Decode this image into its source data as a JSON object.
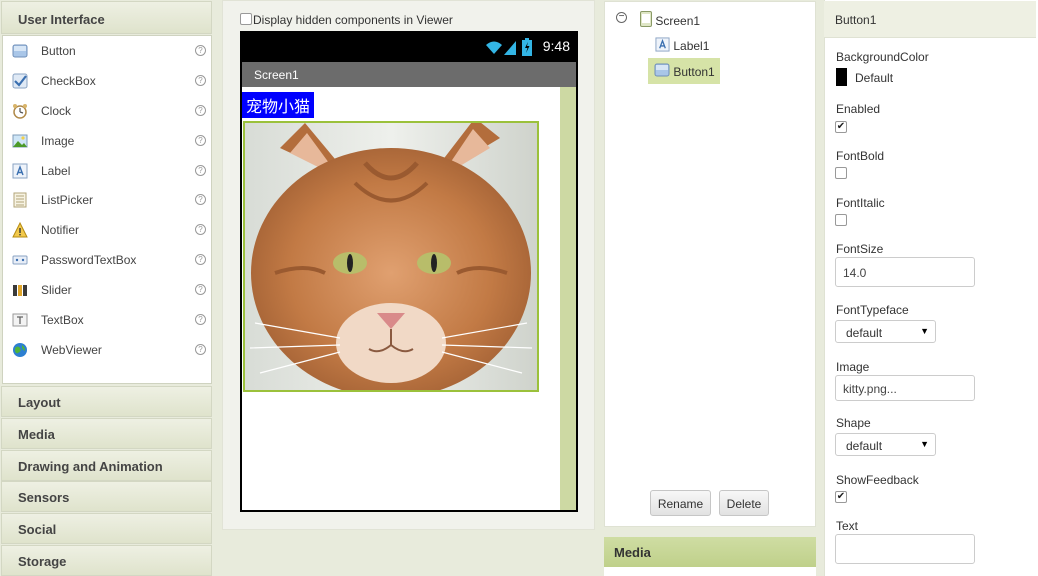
{
  "palette": {
    "title": "User Interface",
    "items": [
      {
        "label": "Button",
        "icon": "button-icon"
      },
      {
        "label": "CheckBox",
        "icon": "checkbox-icon"
      },
      {
        "label": "Clock",
        "icon": "clock-icon"
      },
      {
        "label": "Image",
        "icon": "image-icon"
      },
      {
        "label": "Label",
        "icon": "label-icon"
      },
      {
        "label": "ListPicker",
        "icon": "listpicker-icon"
      },
      {
        "label": "Notifier",
        "icon": "notifier-icon"
      },
      {
        "label": "PasswordTextBox",
        "icon": "password-icon"
      },
      {
        "label": "Slider",
        "icon": "slider-icon"
      },
      {
        "label": "TextBox",
        "icon": "textbox-icon"
      },
      {
        "label": "WebViewer",
        "icon": "webviewer-icon"
      }
    ],
    "help_glyph": "?",
    "categories": [
      "Layout",
      "Media",
      "Drawing and Animation",
      "Sensors",
      "Social",
      "Storage"
    ]
  },
  "viewer": {
    "hidden_components_label": "Display hidden components in Viewer",
    "status_time": "9:48",
    "screen_title": "Screen1",
    "label_text": "宠物小猫"
  },
  "components": {
    "collapse_glyph": "−",
    "tree": [
      {
        "label": "Screen1",
        "icon": "screen-icon"
      },
      {
        "label": "Label1",
        "icon": "label-icon"
      },
      {
        "label": "Button1",
        "icon": "button-icon"
      }
    ],
    "selected": "Button1",
    "rename_label": "Rename",
    "delete_label": "Delete"
  },
  "media": {
    "title": "Media"
  },
  "properties": {
    "component": "Button1",
    "background_color_label": "BackgroundColor",
    "background_color_value": "Default",
    "enabled_label": "Enabled",
    "enabled_checked": true,
    "fontbold_label": "FontBold",
    "fontbold_checked": false,
    "fontitalic_label": "FontItalic",
    "fontitalic_checked": false,
    "fontsize_label": "FontSize",
    "fontsize_value": "14.0",
    "fonttypeface_label": "FontTypeface",
    "fonttypeface_value": "default",
    "image_label": "Image",
    "image_value": "kitty.png...",
    "shape_label": "Shape",
    "shape_value": "default",
    "showfeedback_label": "ShowFeedback",
    "showfeedback_checked": true,
    "text_label": "Text",
    "text_value": "",
    "check_glyph": "✔",
    "dropdown_glyph": "▼"
  },
  "colors": {
    "accent_green": "#9bc13b",
    "selection_green": "#d6e3a7",
    "label_bg": "#0000ff",
    "panel_bg": "#e8ebdc"
  }
}
